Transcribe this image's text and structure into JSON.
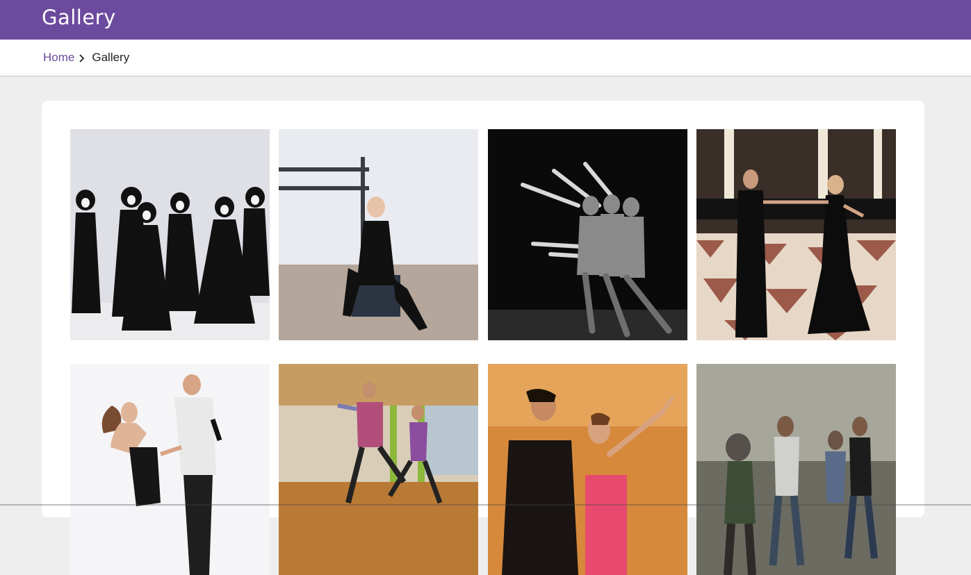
{
  "header": {
    "title": "Gallery"
  },
  "breadcrumb": {
    "home_label": "Home",
    "separator_icon": "chevron-right-icon",
    "current_label": "Gallery"
  },
  "colors": {
    "brand": "#6c4a9e",
    "page_background": "#eeeeee",
    "card_background": "#ffffff"
  },
  "gallery": {
    "images": [
      {
        "name": "mime-dancers-in-black-photo"
      },
      {
        "name": "girl-ballet-studio-photo"
      },
      {
        "name": "black-white-dance-trio-photo"
      },
      {
        "name": "ballroom-couple-dancing-photo"
      },
      {
        "name": "couple-salsa-white-background-photo"
      },
      {
        "name": "dance-studio-jump-photo"
      },
      {
        "name": "latin-couple-orange-photo"
      },
      {
        "name": "group-dancers-smoke-stage-photo"
      }
    ]
  }
}
